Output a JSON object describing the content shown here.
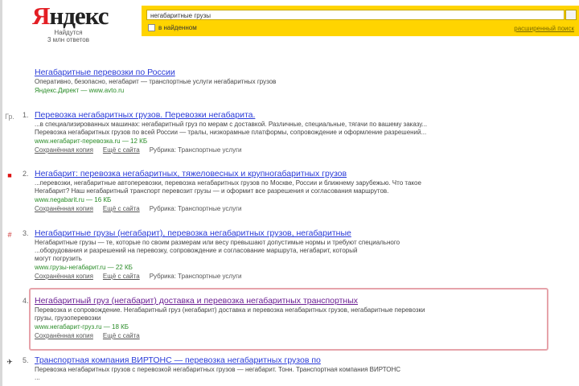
{
  "logo": {
    "text_first": "Я",
    "text_rest": "ндекс",
    "sub1": "Найдутся",
    "sub2": "3 млн ответов"
  },
  "search": {
    "query": "негабаритные грузы",
    "region_label": "в найденном",
    "advanced_label": "расширенный поиск"
  },
  "ad": {
    "title": "Негабаритные перевозки по России",
    "snippet": "Оперативно, безопасно, негабарит — транспортные услуги негабаритных грузов",
    "url": "Яндекс.Директ — www.avto.ru"
  },
  "results": [
    {
      "num": "1.",
      "favicon": "Гр.",
      "title": "Перевозка негабаритных грузов. Перевозки негабарита.",
      "snip1": "...в специализированных машинах: негабаритный груз по мерам с доставкой. Различные, специальные, тягачи по вашему заказу...",
      "snip2": "Перевозка негабаритных грузов по всей России — тралы, низкорамные платформы, сопровождение и оформление разрешений...",
      "url": "www.негабарит-перевозка.ru — 12 КБ",
      "meta1": "Сохранённая копия",
      "meta2": "Ещё с сайта",
      "meta3": "Рубрика: Транспортные услуги"
    },
    {
      "num": "2.",
      "favicon": "■",
      "title": "Негабарит: перевозка негабаритных, тяжеловесных и крупногабаритных грузов",
      "snip1": "...перевозки, негабаритные автоперевозки, перевозка негабаритных грузов по Москве, России и ближнему зарубежью. Что такое",
      "snip2": "Негабарит? Наш негабаритный транспорт перевозит грузы — и оформит все разрешения и согласования маршрутов.",
      "url": "www.negabarit.ru — 16 КБ",
      "meta1": "Сохранённая копия",
      "meta2": "Ещё с сайта",
      "meta3": "Рубрика: Транспортные услуги"
    },
    {
      "num": "3.",
      "favicon": "#",
      "title": "Негабаритные грузы (негабарит), перевозка негабаритных грузов, негабаритные",
      "snip1": "Негабаритные грузы — те, которые по своим размерам или весу превышают допустимые нормы и требуют специального",
      "snip2": "...оборудования и разрешений на перевозку, сопровождение и согласование маршрута, негабарит, который",
      "snip3": "могут погрузить",
      "url": "www.грузы-негабарит.ru — 22 КБ",
      "meta1": "Сохранённая копия",
      "meta2": "Ещё с сайта",
      "meta3": "Рубрика: Транспортные услуги"
    },
    {
      "num": "4.",
      "favicon": "",
      "title": "Негабаритный груз (негабарит) доставка и перевозка негабаритных транспортных",
      "snip1": "Перевозка и сопровождение. Негабаритный груз (негабарит) доставка и перевозка негабаритных грузов, негабаритные перевозки",
      "snip2": "грузы, грузоперевозки",
      "url": "www.негабарит-груз.ru — 18 КБ",
      "meta1": "Сохранённая копия",
      "meta2": "Ещё с сайта"
    },
    {
      "num": "5.",
      "favicon": "✈",
      "title": "Транспортная компания ВИРТОНС — перевозка негабаритных грузов по",
      "snip1": "Перевозка негабаритных грузов с перевозкой негабаритных грузов — негабарит. Тонн. Транспортная компания ВИРТОНС",
      "snip2": "..."
    }
  ]
}
